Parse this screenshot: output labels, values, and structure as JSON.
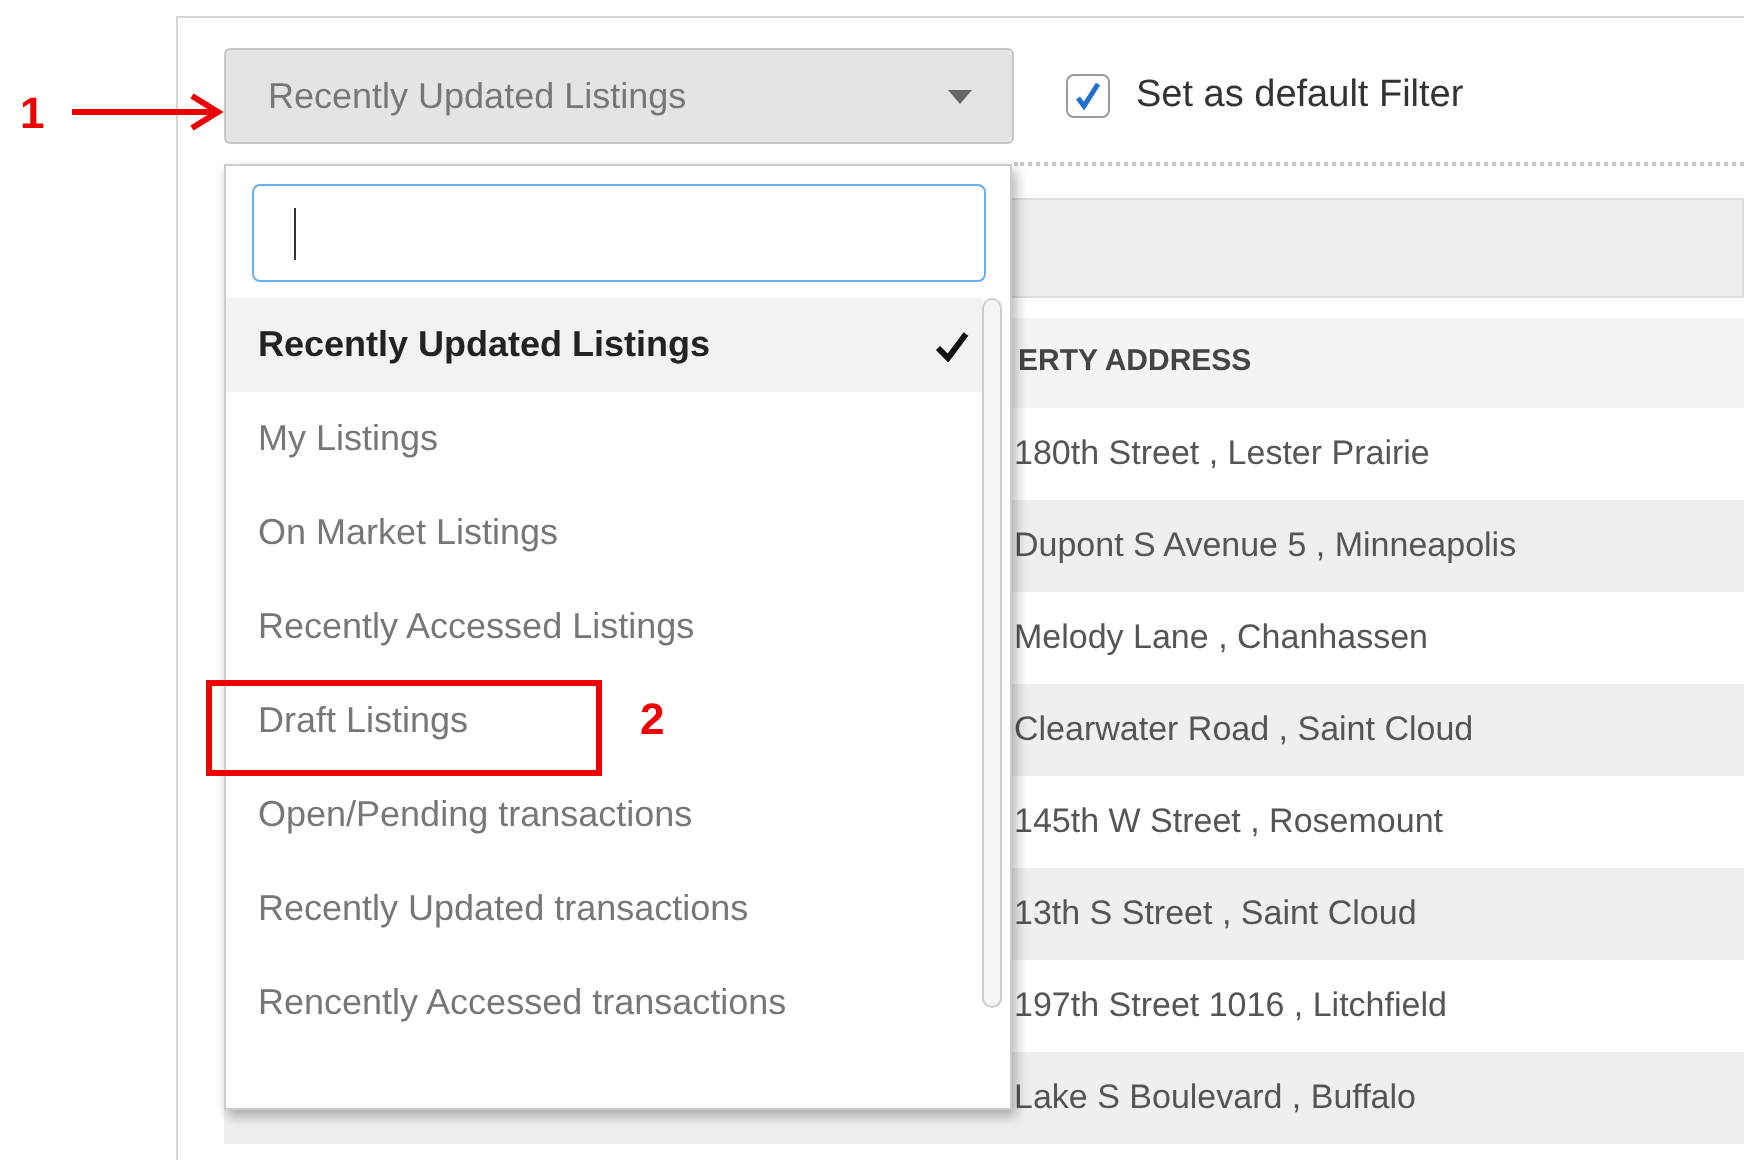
{
  "filter_select": {
    "value": "Recently Updated Listings",
    "expanded": true
  },
  "default_filter": {
    "label": "Set as default Filter",
    "checked": true
  },
  "dropdown": {
    "items": [
      {
        "label": "Recently Updated Listings",
        "selected": true
      },
      {
        "label": "My Listings",
        "selected": false
      },
      {
        "label": "On Market Listings",
        "selected": false
      },
      {
        "label": "Recently Accessed Listings",
        "selected": false
      },
      {
        "label": "Draft Listings",
        "selected": false
      },
      {
        "label": "Open/Pending transactions",
        "selected": false
      },
      {
        "label": "Recently Updated transactions",
        "selected": false
      },
      {
        "label": "Rencently Accessed transactions",
        "selected": false
      }
    ]
  },
  "table": {
    "columns": [
      "ERTY ADDRESS"
    ],
    "rows": [
      "180th Street , Lester Prairie",
      "Dupont S Avenue 5 , Minneapolis",
      "Melody Lane , Chanhassen",
      "Clearwater Road , Saint Cloud",
      "145th W Street , Rosemount",
      "13th S Street , Saint Cloud",
      "197th Street 1016 , Litchfield",
      "Lake S Boulevard , Buffalo"
    ]
  },
  "annotations": [
    {
      "kind": "arrow",
      "label": "1"
    },
    {
      "kind": "box",
      "label": "2"
    }
  ]
}
